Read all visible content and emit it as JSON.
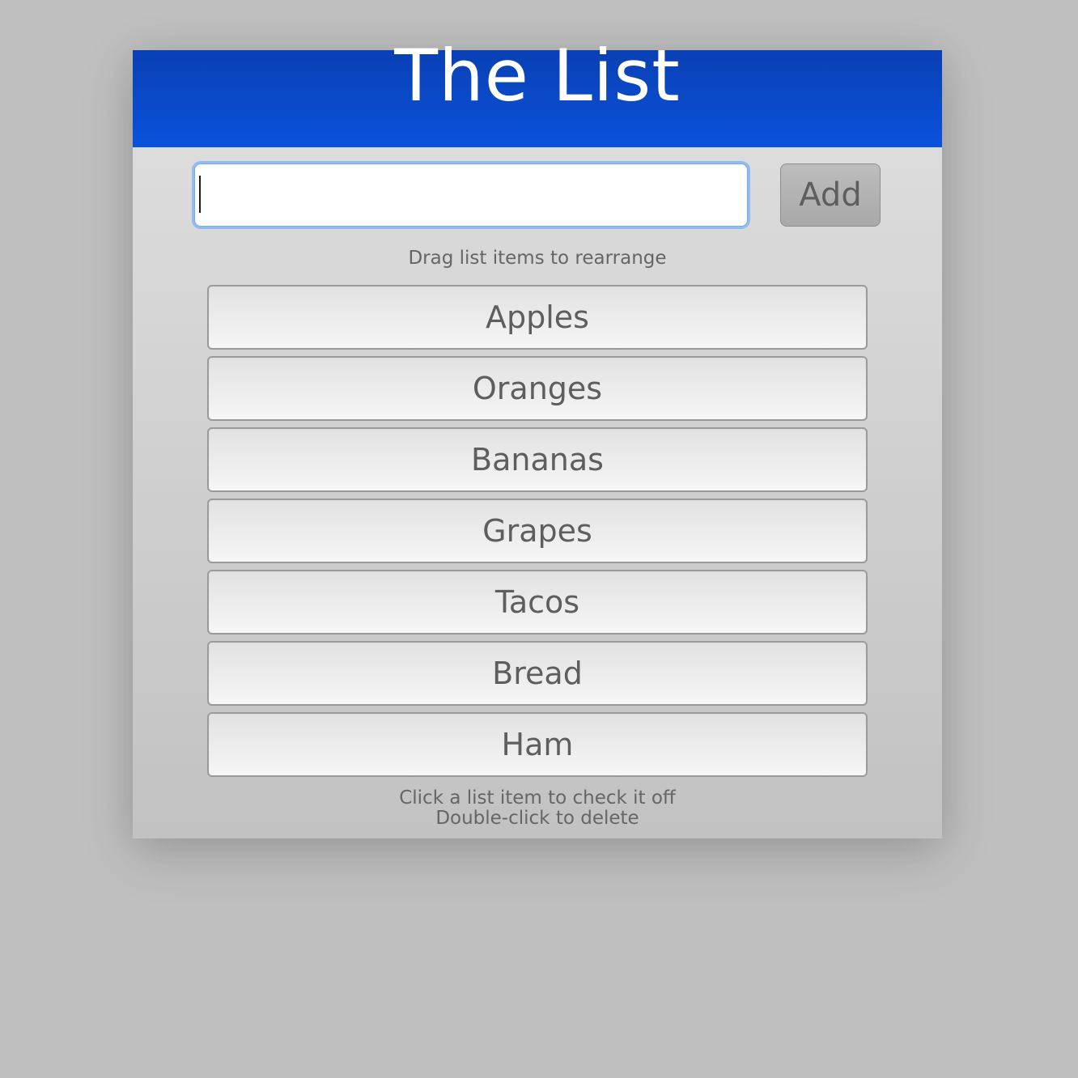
{
  "header": {
    "title": "The List"
  },
  "new_item": {
    "value": "",
    "add_label": "Add"
  },
  "hints": {
    "drag": "Drag list items to rearrange",
    "check": "Click a list item to check it off",
    "delete": "Double-click to delete"
  },
  "items": [
    {
      "label": "Apples"
    },
    {
      "label": "Oranges"
    },
    {
      "label": "Bananas"
    },
    {
      "label": "Grapes"
    },
    {
      "label": "Tacos"
    },
    {
      "label": "Bread"
    },
    {
      "label": "Ham"
    }
  ],
  "colors": {
    "header_blue": "#0b4fd6",
    "page_background": "#bfbfbf",
    "text_gray": "#5e5e5e",
    "focus_ring": "#8ebcf3"
  }
}
